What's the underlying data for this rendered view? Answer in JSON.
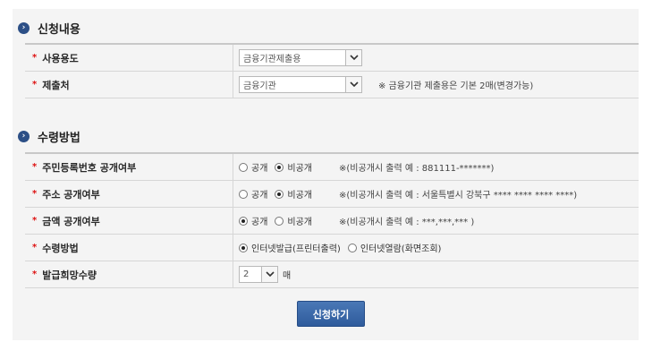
{
  "sections": {
    "application": {
      "title": "신청내용",
      "usage": {
        "label": "사용용도",
        "value": "금융기관제출용"
      },
      "submit_to": {
        "label": "제출처",
        "value": "금융기관",
        "note": "※ 금융기관 제출용은 기본 2매(변경가능)"
      }
    },
    "receipt": {
      "title": "수령방법",
      "rows": [
        {
          "label": "주민등록번호 공개여부",
          "options": [
            "공개",
            "비공개"
          ],
          "checked": 1,
          "note": "※(비공개시 출력 예 : 881111-*******)"
        },
        {
          "label": "주소 공개여부",
          "options": [
            "공개",
            "비공개"
          ],
          "checked": 1,
          "note": "※(비공개시 출력 예 : 서울특별시 강북구 **** **** **** ****)"
        },
        {
          "label": "금액 공개여부",
          "options": [
            "공개",
            "비공개"
          ],
          "checked": 0,
          "note": "※(비공개시 출력 예 : ***,***,*** )"
        },
        {
          "label": "수령방법",
          "options": [
            "인터넷발급(프린터출력)",
            "인터넷열람(화면조회)"
          ],
          "checked": 0,
          "note": ""
        }
      ],
      "quantity": {
        "label": "발급희망수량",
        "value": "2",
        "unit": "매"
      }
    }
  },
  "submit_label": "신청하기",
  "colors": {
    "accent": "#2c4f86",
    "star": "#dd1111",
    "button": "#3a67a8"
  }
}
